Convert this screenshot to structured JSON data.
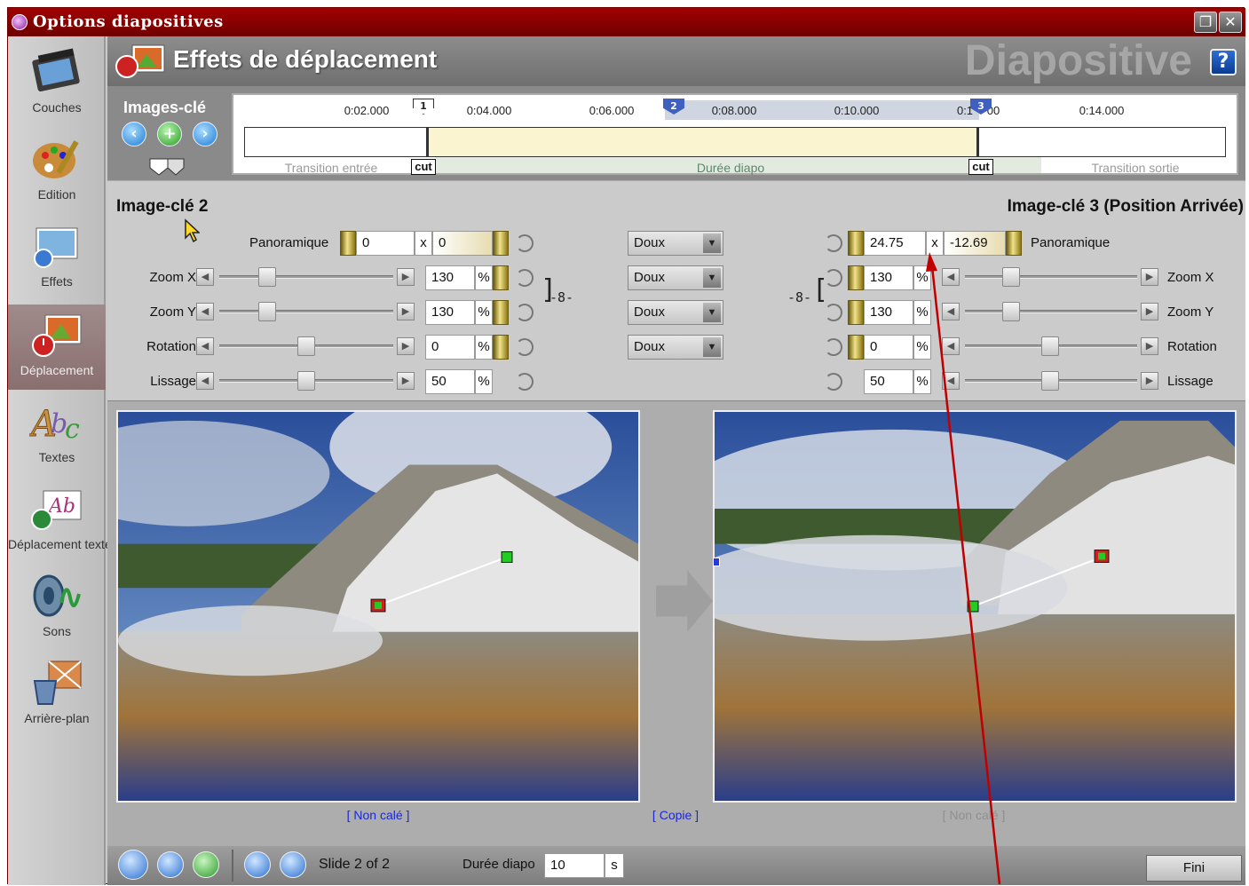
{
  "window": {
    "title": "Options diapositives"
  },
  "sidebar": {
    "items": [
      {
        "label": "Couches",
        "icon": "film-strip-icon"
      },
      {
        "label": "Edition",
        "icon": "palette-icon"
      },
      {
        "label": "Effets",
        "icon": "effects-photo-icon"
      },
      {
        "label": "Déplacement",
        "icon": "move-photo-icon",
        "active": true
      },
      {
        "label": "Textes",
        "icon": "abc-text-icon"
      },
      {
        "label": "Déplacement texte",
        "icon": "text-move-icon"
      },
      {
        "label": "Sons",
        "icon": "sound-wave-icon"
      },
      {
        "label": "Arrière-plan",
        "icon": "paint-bucket-icon"
      }
    ]
  },
  "header": {
    "title": "Effets de déplacement",
    "brand": "Diapositive",
    "help_label": "?"
  },
  "keyframes": {
    "title": "Images-clé"
  },
  "timeline": {
    "ticks": [
      "0:02.000",
      "0:04.000",
      "0:06.000",
      "0:08.000",
      "0:10.000",
      "0:1",
      "00",
      "0:14.000"
    ],
    "markers": [
      "1",
      "2",
      "3"
    ],
    "cut_label": "cut",
    "transition_in": "Transition entrée",
    "duration_label": "Durée diapo",
    "transition_out": "Transition sortie"
  },
  "left_keyframe": {
    "title": "Image-clé 2",
    "pan_label": "Panoramique",
    "pan_x": "0",
    "pan_sep": "x",
    "pan_y": "0",
    "rows": [
      {
        "label": "Zoom X",
        "value": "130",
        "unit": "%"
      },
      {
        "label": "Zoom Y",
        "value": "130",
        "unit": "%"
      },
      {
        "label": "Rotation",
        "value": "0",
        "unit": "%"
      },
      {
        "label": "Lissage",
        "value": "50",
        "unit": "%"
      }
    ]
  },
  "easing": {
    "options": [
      "Doux",
      "Doux",
      "Doux",
      "Doux"
    ]
  },
  "right_keyframe": {
    "title": "Image-clé 3 (Position Arrivée)",
    "pan_label": "Panoramique",
    "pan_x": "24.75",
    "pan_sep": "x",
    "pan_y": "-12.69",
    "rows": [
      {
        "label": "Zoom X",
        "value": "130",
        "unit": "%"
      },
      {
        "label": "Zoom Y",
        "value": "130",
        "unit": "%"
      },
      {
        "label": "Rotation",
        "value": "0",
        "unit": "%"
      },
      {
        "label": "Lissage",
        "value": "50",
        "unit": "%"
      }
    ]
  },
  "link_symbol": "-8-",
  "preview": {
    "left_caption": "[ Non calé ]",
    "copy_caption": "[ Copie ]",
    "right_caption": "[ Non calé ]"
  },
  "footer": {
    "slide_info": "Slide 2 of 2",
    "duration_label": "Durée diapo",
    "duration_value": "10",
    "duration_unit": "s",
    "done_label": "Fini"
  },
  "colors": {
    "title_bar": "#8b0000",
    "annotation_arrow": "#c00000",
    "caption_link": "#1a28d8"
  }
}
